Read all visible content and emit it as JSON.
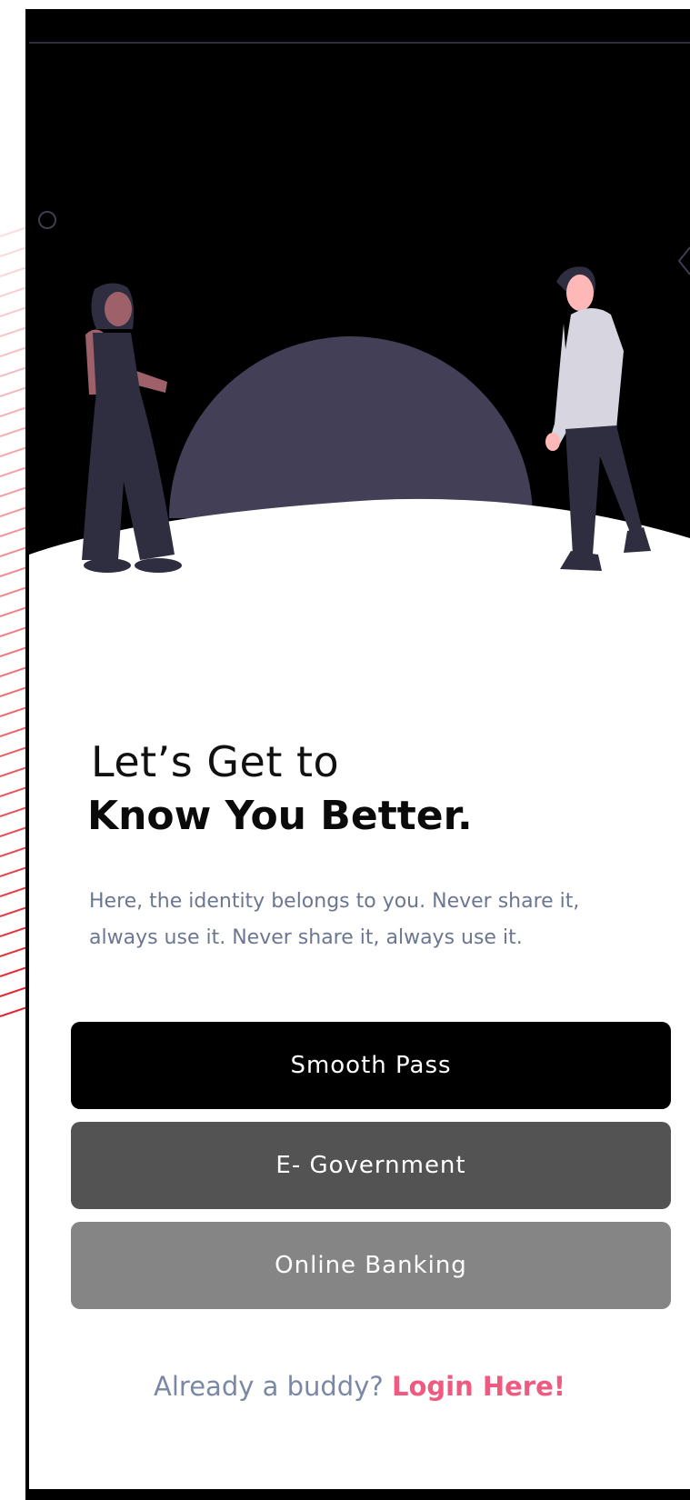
{
  "screen": {
    "headline_line1": "Let’s Get to",
    "headline_line2": "Know You Better.",
    "subtitle": "Here, the identity belongs to you. Never share it, always use it. Never share it, always use it."
  },
  "options": [
    {
      "label": "Smooth Pass",
      "color": "#000000"
    },
    {
      "label": "E- Government",
      "color": "#535353"
    },
    {
      "label": "Online Banking",
      "color": "#858585"
    }
  ],
  "footer": {
    "prompt": "Already a buddy?",
    "link": "Login Here!",
    "link_color": "#ef5a80"
  },
  "colors": {
    "hero_background": "#000000",
    "moon": "#423f57",
    "subtitle_text": "#6b7792"
  }
}
